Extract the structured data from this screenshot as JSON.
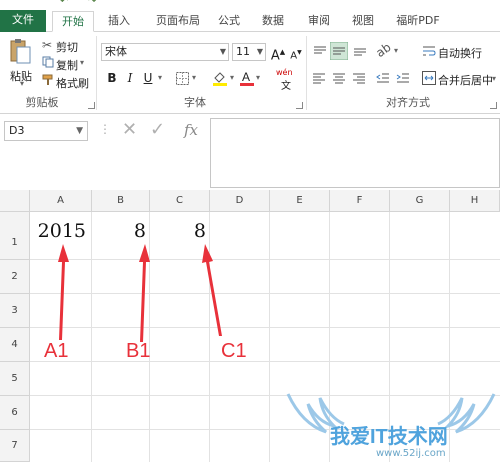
{
  "tabs": {
    "file": "文件",
    "items": [
      "开始",
      "插入",
      "页面布局",
      "公式",
      "数据",
      "审阅",
      "视图",
      "福昕PDF"
    ]
  },
  "clipboard": {
    "paste": "粘贴",
    "cut": "剪切",
    "copy": "复制",
    "format_painter": "格式刷",
    "group_label": "剪贴板"
  },
  "font": {
    "name": "宋体",
    "size": "11",
    "bold": "B",
    "italic": "I",
    "underline": "U",
    "grow": "A",
    "shrink": "A",
    "wen": "wén",
    "group_label": "字体"
  },
  "alignment": {
    "wrap_text": "自动换行",
    "merge_center": "合并后居中",
    "group_label": "对齐方式"
  },
  "formula_bar": {
    "name_box": "D3",
    "fx": "fx"
  },
  "sheet": {
    "columns": [
      "A",
      "B",
      "C",
      "D",
      "E",
      "F",
      "G",
      "H"
    ],
    "rows": [
      "1",
      "2",
      "3",
      "4",
      "5",
      "6",
      "7"
    ],
    "cells": {
      "A1": "2015",
      "B1": "8",
      "C1": "8"
    }
  },
  "annotations": {
    "a1": "A1",
    "b1": "B1",
    "c1": "C1"
  },
  "colors": {
    "file_tab": "#217346",
    "annotation": "#e8313a",
    "watermark": "#4fa3dd"
  },
  "watermark": {
    "text": "我爱IT技术网",
    "url": "www.52ij.com"
  }
}
